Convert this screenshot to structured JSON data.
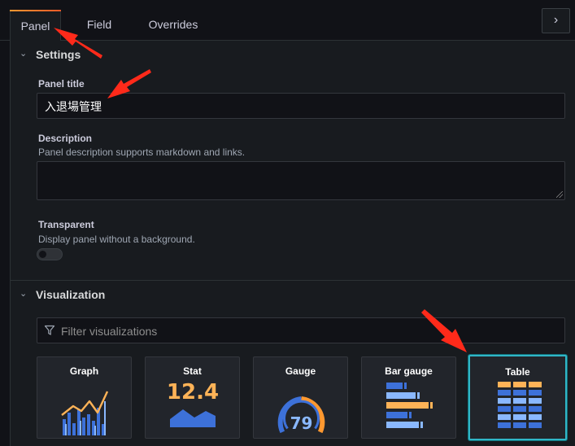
{
  "tabs": [
    {
      "label": "Panel",
      "active": true
    },
    {
      "label": "Field",
      "active": false
    },
    {
      "label": "Overrides",
      "active": false
    }
  ],
  "collapse_icon": "chevron-right-icon",
  "settings": {
    "title": "Settings",
    "panel_title_label": "Panel title",
    "panel_title_value": "入退場管理",
    "description_label": "Description",
    "description_hint": "Panel description supports markdown and links.",
    "description_value": "",
    "transparent_label": "Transparent",
    "transparent_hint": "Display panel without a background.",
    "transparent_on": false
  },
  "visualization": {
    "title": "Visualization",
    "filter_placeholder": "Filter visualizations",
    "cards": [
      {
        "label": "Graph",
        "icon": "graph-icon"
      },
      {
        "label": "Stat",
        "icon": "stat-icon",
        "value": "12.4"
      },
      {
        "label": "Gauge",
        "icon": "gauge-icon",
        "value": "79"
      },
      {
        "label": "Bar gauge",
        "icon": "bar-gauge-icon"
      },
      {
        "label": "Table",
        "icon": "table-icon",
        "selected": true
      }
    ]
  },
  "colors": {
    "accent_orange": "#ff9830",
    "selected_border": "#30b6c7",
    "annotation_arrow": "#ff2a1a"
  }
}
